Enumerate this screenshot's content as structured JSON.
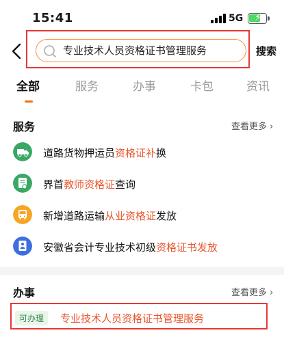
{
  "status_bar": {
    "time": "15:41",
    "network": "5G"
  },
  "search": {
    "query": "专业技术人员资格证书管理服务",
    "button_label": "搜索"
  },
  "tabs": [
    {
      "label": "全部"
    },
    {
      "label": "服务"
    },
    {
      "label": "办事"
    },
    {
      "label": "卡包"
    },
    {
      "label": "资讯"
    }
  ],
  "services": {
    "title": "服务",
    "more_label": "查看更多",
    "items": [
      {
        "icon": "truck-icon",
        "icon_color": "#3aa864",
        "pre": "道路货物押运员",
        "hl": "资格证补",
        "post": "换"
      },
      {
        "icon": "certificate-icon",
        "icon_color": "#3aa864",
        "pre": "界首",
        "hl": "教师资格证",
        "post": "查询"
      },
      {
        "icon": "bus-icon",
        "icon_color": "#f5a623",
        "pre": "新增道路运输",
        "hl": "从业资格证",
        "post": "发放"
      },
      {
        "icon": "document-icon",
        "icon_color": "#3d6fe0",
        "pre": "安徽省会计专业技术初级",
        "hl": "资格证书发放",
        "post": ""
      }
    ]
  },
  "tasks": {
    "title": "办事",
    "more_label": "查看更多",
    "items": [
      {
        "badge": "可办理",
        "label": "专业技术人员资格证书管理服务"
      }
    ]
  },
  "colors": {
    "accent": "#ff6a00",
    "highlight": "#e8552c",
    "annotation_red": "#e53935"
  }
}
